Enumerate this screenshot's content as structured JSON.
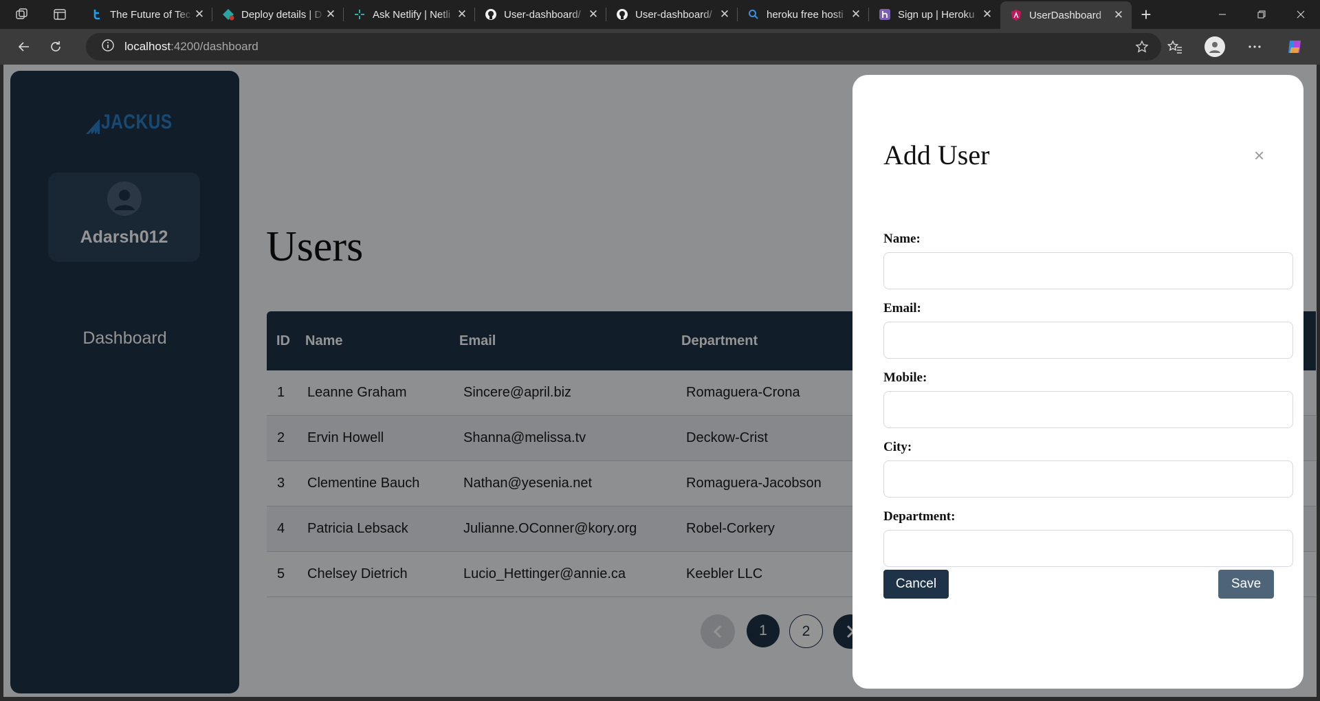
{
  "browser": {
    "tabs": [
      {
        "title": "The Future of Tec",
        "favicon": "tech-icon",
        "active": false
      },
      {
        "title": "Deploy details | D",
        "favicon": "netlify-deploy-icon",
        "active": false
      },
      {
        "title": "Ask Netlify | Netli",
        "favicon": "netlify-icon",
        "active": false
      },
      {
        "title": "User-dashboard/",
        "favicon": "github-icon",
        "active": false
      },
      {
        "title": "User-dashboard/",
        "favicon": "github-icon",
        "active": false
      },
      {
        "title": "heroku free hosti",
        "favicon": "search-icon",
        "active": false
      },
      {
        "title": "Sign up | Heroku",
        "favicon": "heroku-icon",
        "active": false
      },
      {
        "title": "UserDashboard",
        "favicon": "angular-icon",
        "active": true
      }
    ],
    "url": {
      "host": "localhost",
      "rest": ":4200/dashboard"
    }
  },
  "sidebar": {
    "logo_text": "JACKUS",
    "username": "Adarsh012",
    "nav": {
      "dashboard_label": "Dashboard"
    }
  },
  "main": {
    "title": "Users",
    "table": {
      "headers": {
        "id": "ID",
        "name": "Name",
        "email": "Email",
        "department": "Department"
      },
      "rows": [
        {
          "id": "1",
          "name": "Leanne Graham",
          "email": "Sincere@april.biz",
          "department": "Romaguera-Crona"
        },
        {
          "id": "2",
          "name": "Ervin Howell",
          "email": "Shanna@melissa.tv",
          "department": "Deckow-Crist"
        },
        {
          "id": "3",
          "name": "Clementine Bauch",
          "email": "Nathan@yesenia.net",
          "department": "Romaguera-Jacobson"
        },
        {
          "id": "4",
          "name": "Patricia Lebsack",
          "email": "Julianne.OConner@kory.org",
          "department": "Robel-Corkery"
        },
        {
          "id": "5",
          "name": "Chelsey Dietrich",
          "email": "Lucio_Hettinger@annie.ca",
          "department": "Keebler LLC"
        }
      ]
    },
    "pagination": {
      "pages": [
        "1",
        "2"
      ],
      "current": "1"
    }
  },
  "modal": {
    "title": "Add User",
    "close_symbol": "×",
    "fields": {
      "name": {
        "label": "Name:",
        "value": ""
      },
      "email": {
        "label": "Email:",
        "value": ""
      },
      "mobile": {
        "label": "Mobile:",
        "value": ""
      },
      "city": {
        "label": "City:",
        "value": ""
      },
      "department": {
        "label": "Department:",
        "value": ""
      }
    },
    "cancel_label": "Cancel",
    "save_label": "Save"
  },
  "colors": {
    "primary": "#1e3347",
    "save_button": "#4e6478",
    "logo_blue": "#2a7fc4"
  }
}
